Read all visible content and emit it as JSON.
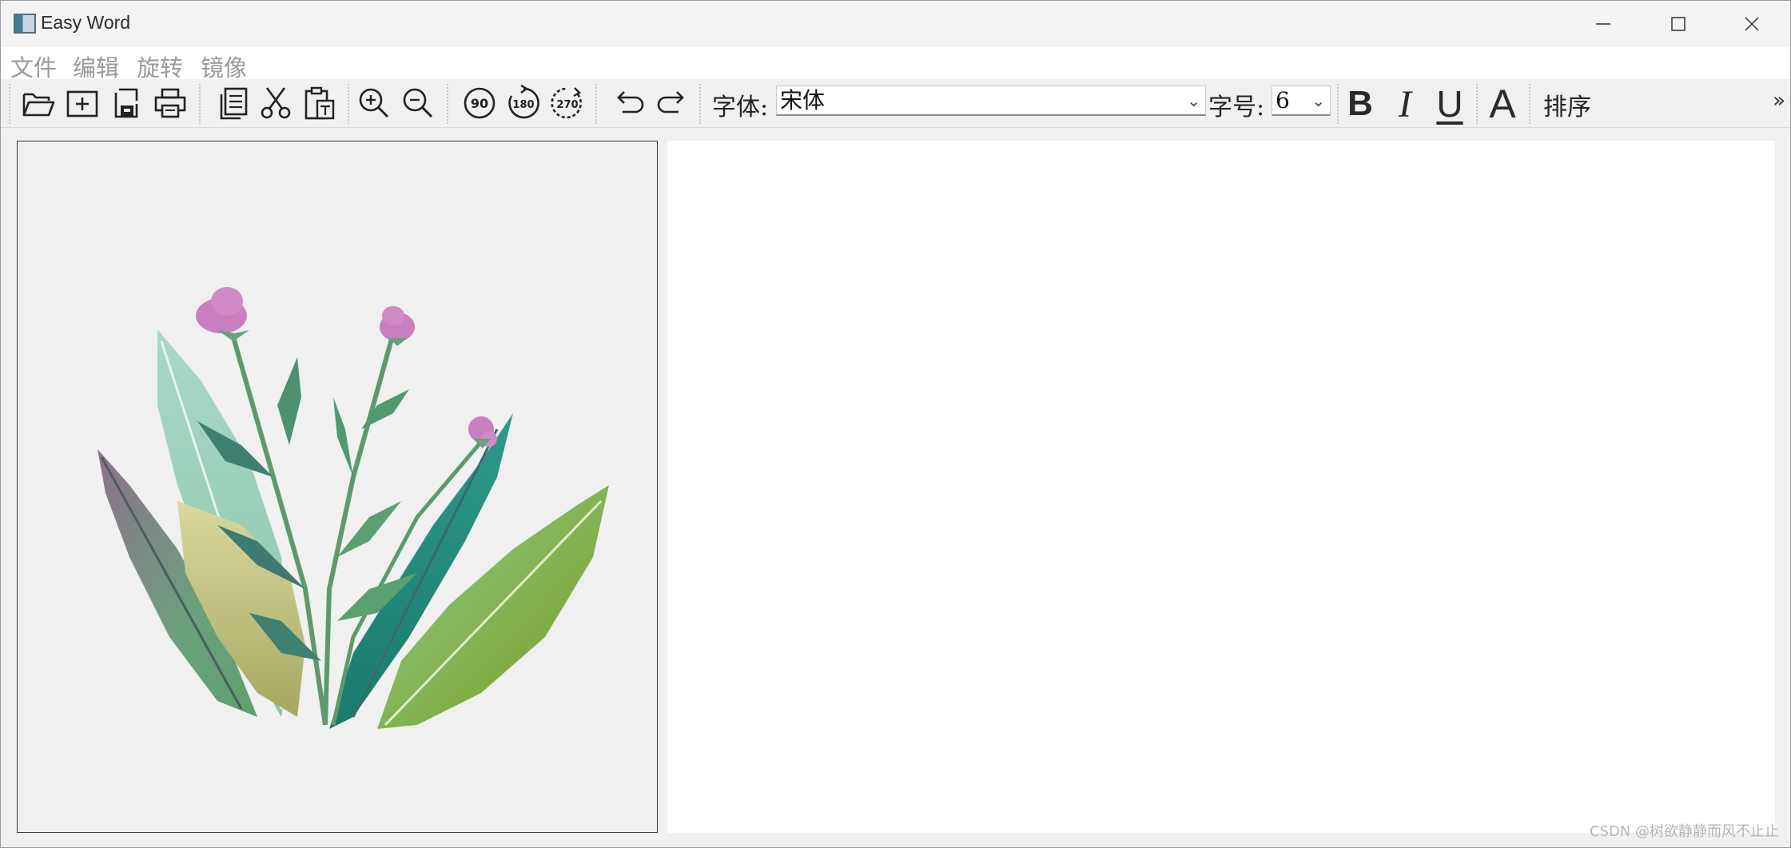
{
  "window": {
    "title": "Easy Word"
  },
  "menu": [
    "文件",
    "编辑",
    "旋转",
    "镜像"
  ],
  "toolbar": {
    "file_buttons": [
      "open-icon",
      "new-icon",
      "save-icon",
      "print-icon"
    ],
    "edit_buttons": [
      "copy-icon",
      "cut-icon",
      "paste-icon"
    ],
    "zoom_buttons": [
      "zoom-in-icon",
      "zoom-out-icon"
    ],
    "rotate_labels": [
      "90",
      "180",
      "270"
    ],
    "font_label": "字体:",
    "font_value": "宋体",
    "size_label": "字号:",
    "size_value": "6",
    "bold": "B",
    "italic": "I",
    "underline": "U",
    "color": "A",
    "sort_label": "排序",
    "overflow": "»"
  },
  "watermark": "CSDN @树欲静静而风不止止"
}
